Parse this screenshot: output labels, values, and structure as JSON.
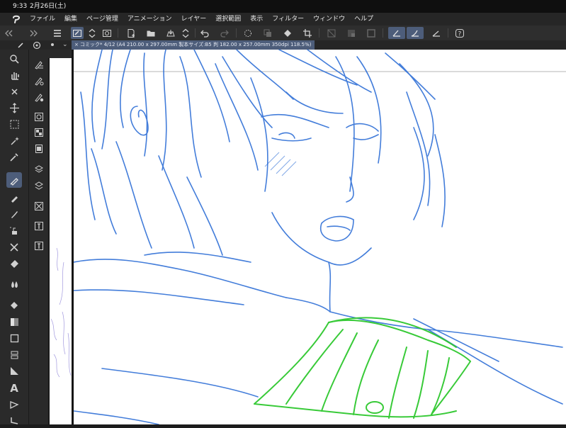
{
  "status_bar": {
    "time": "9:33",
    "date": "2月26日(土)"
  },
  "menu": [
    "ファイル",
    "編集",
    "ページ管理",
    "アニメーション",
    "レイヤー",
    "選択範囲",
    "表示",
    "フィルター",
    "ウィンドウ",
    "ヘルプ"
  ],
  "document": {
    "tab_title": "コミック* 4/12 (A4 210.00 x 297.00mm 製本サイズ:B5 判 182.00 x 257.00mm 350dpi 118.5%)"
  },
  "toolbar": {
    "commands": [
      "menu-icon",
      "pen-settings-icon",
      "up-down-icon",
      "layer-property-icon",
      "new-page-icon",
      "open-folder-icon",
      "save-icon",
      "up-down-icon",
      "undo-icon",
      "redo-icon",
      "loading-icon",
      "copy-icon",
      "fill-icon",
      "crop-icon",
      "clear-icon",
      "gradient-icon",
      "square-icon",
      "stabilizer-1-icon",
      "stabilizer-2-icon",
      "stabilizer-3-icon",
      "help-icon"
    ]
  },
  "tools": [
    "zoom-icon",
    "hand-icon",
    "rotate-view-icon",
    "move-icon",
    "selection-icon",
    "magic-wand-icon",
    "eyedropper-icon",
    "pen-icon",
    "pencil-icon",
    "brush-icon",
    "airbrush-icon",
    "decoration-icon",
    "eraser-icon",
    "blend-icon",
    "fill-icon",
    "gradient-icon",
    "figure-icon",
    "frame-icon",
    "ruler-icon",
    "text-icon",
    "balloon-icon",
    "correction-icon"
  ],
  "subtools": [
    "pen-sub-1-icon",
    "pen-sub-2-icon",
    "pen-sub-3-icon",
    "circle-tool-icon",
    "grid-tool-icon",
    "layer-tool-icon",
    "layers-stack-icon",
    "layers-icon",
    "frame-tool-icon",
    "frame-tool-2-icon",
    "frame-tool-3-icon"
  ],
  "colors": {
    "sketch_blue": "#2f6fd6",
    "sketch_green": "#2ec82e",
    "active_blue": "#4d5d7a",
    "panel_bg": "#2a2a2a",
    "bar_bg": "#262626"
  }
}
